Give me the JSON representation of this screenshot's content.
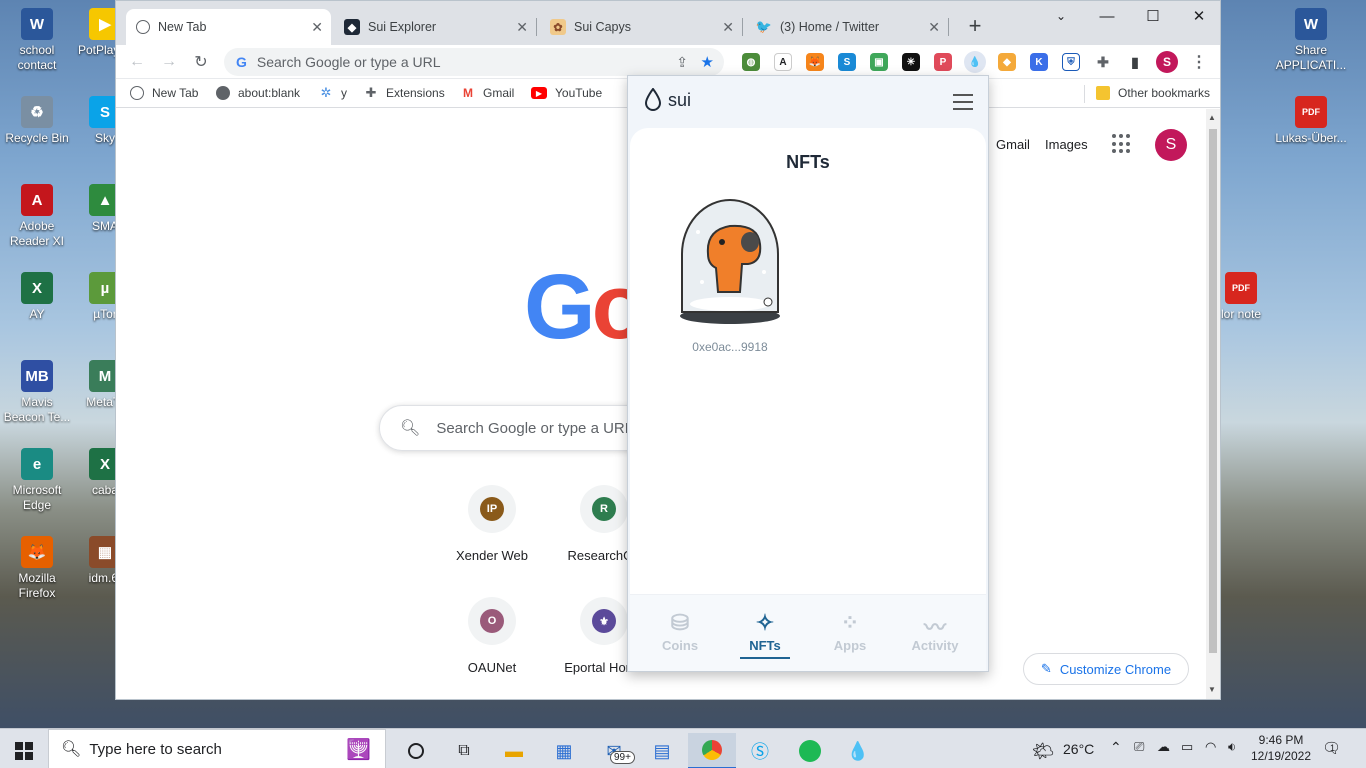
{
  "desktop": {
    "icons_left": [
      {
        "label": "school contact",
        "glyph": "W",
        "color": "#2b579a",
        "icon": "word-doc-icon"
      },
      {
        "label": "Recycle Bin",
        "glyph": "♻",
        "color": "#7a8fa3",
        "icon": "recycle-bin-icon"
      },
      {
        "label": "Adobe Reader XI",
        "glyph": "A",
        "color": "#c4161c",
        "icon": "adobe-reader-icon"
      },
      {
        "label": "AY",
        "glyph": "X",
        "color": "#1e7145",
        "icon": "excel-icon"
      },
      {
        "label": "Mavis Beacon Te...",
        "glyph": "MB",
        "color": "#2f4fa3",
        "icon": "mavis-beacon-icon"
      },
      {
        "label": "Microsoft Edge",
        "glyph": "e",
        "color": "#1a8b83",
        "icon": "edge-icon"
      },
      {
        "label": "Mozilla Firefox",
        "glyph": "🦊",
        "color": "#e66000",
        "icon": "firefox-icon"
      }
    ],
    "icons_left2": [
      {
        "label": "PotPlay bi",
        "glyph": "▶",
        "color": "#f6c700",
        "icon": "potplayer-icon"
      },
      {
        "label": "Sky",
        "glyph": "S",
        "color": "#0aa3e8",
        "icon": "skype-icon"
      },
      {
        "label": "SMA",
        "glyph": "▲",
        "color": "#2e8b3e",
        "icon": "sma-icon"
      },
      {
        "label": "µTor",
        "glyph": "µ",
        "color": "#5c9a3b",
        "icon": "utorrent-icon"
      },
      {
        "label": "MetaTr",
        "glyph": "M",
        "color": "#3a7d5a",
        "icon": "metatrader-icon"
      },
      {
        "label": "caba",
        "glyph": "X",
        "color": "#1e7145",
        "icon": "excel-icon"
      },
      {
        "label": "idm.6.",
        "glyph": "▦",
        "color": "#8a4b2a",
        "icon": "winrar-icon"
      }
    ],
    "icons_right": [
      {
        "label": "Share APPLICATI...",
        "glyph": "W",
        "color": "#2b579a",
        "icon": "word-doc-icon"
      },
      {
        "label": "Lukas-Über...",
        "glyph": "PDF",
        "color": "#d7261e",
        "icon": "pdf-icon"
      },
      {
        "label": "lor note",
        "glyph": "PDF",
        "color": "#d7261e",
        "icon": "pdf-icon"
      }
    ]
  },
  "browser": {
    "tabs": [
      {
        "title": "New Tab",
        "fav": "◎",
        "favbg": "#ffffff",
        "favcolor": "#5f6368"
      },
      {
        "title": "Sui Explorer",
        "fav": "◆",
        "favbg": "#1f2937",
        "favcolor": "#ffffff"
      },
      {
        "title": "Sui Capys",
        "fav": "✿",
        "favbg": "#f0c98a",
        "favcolor": "#8a4b2a"
      },
      {
        "title": "(3) Home / Twitter",
        "fav": "🐦",
        "favbg": "#ffffff",
        "favcolor": "#1d9bf0"
      }
    ],
    "new_tab_symbol": "+",
    "omnibox_placeholder": "Search Google or type a URL",
    "bookmarks": [
      {
        "label": "New Tab",
        "glyph": "◎",
        "color": "#5f6368"
      },
      {
        "label": "about:blank",
        "glyph": "◉",
        "color": "#5f6368"
      },
      {
        "label": "y",
        "glyph": "✲",
        "color": "#4a90e2"
      },
      {
        "label": "Extensions",
        "glyph": "✚",
        "color": "#5f6368"
      },
      {
        "label": "Gmail",
        "glyph": "M",
        "color": "#ea4335"
      },
      {
        "label": "YouTube",
        "glyph": "▶",
        "color": "#ff0000"
      }
    ],
    "other_bookmarks": "Other bookmarks",
    "avatar_letter": "S"
  },
  "newtab": {
    "gmail": "Gmail",
    "images": "Images",
    "logo_visible": "Go",
    "search_placeholder": "Search Google or type a URL",
    "shortcuts": [
      {
        "label": "Xender Web",
        "letter": "IP",
        "color": "#8a5a1a"
      },
      {
        "label": "ResearchGa",
        "letter": "R",
        "color": "#2e7d4f"
      },
      {
        "label": "OAUNet",
        "letter": "O",
        "color": "#9a5a7a"
      },
      {
        "label": "Eportal Home",
        "letter": "⚜",
        "color": "#5b4a9a"
      }
    ],
    "customize": "Customize Chrome"
  },
  "wallet": {
    "brand": "sui",
    "heading": "NFTs",
    "nft": {
      "id_short": "0xe0ac...9918",
      "badge": "sui"
    },
    "nav": [
      {
        "label": "Coins",
        "icon": "coins-icon",
        "active": false
      },
      {
        "label": "NFTs",
        "icon": "sparkle-icon",
        "active": true
      },
      {
        "label": "Apps",
        "icon": "apps-icon",
        "active": false
      },
      {
        "label": "Activity",
        "icon": "activity-icon",
        "active": false
      }
    ],
    "accent": "#1f6493"
  },
  "taskbar": {
    "search_placeholder": "Type here to search",
    "mail_badge": "99+",
    "weather": "26°C",
    "time": "9:46 PM",
    "date": "12/19/2022",
    "notification_count": "1"
  }
}
